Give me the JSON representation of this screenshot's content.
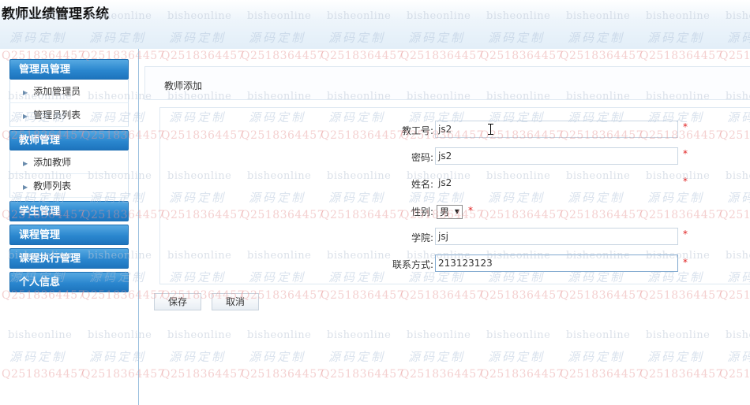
{
  "app": {
    "title": "教师业绩管理系统"
  },
  "sidebar": {
    "groups": [
      {
        "label": "管理员管理",
        "items": [
          {
            "label": "添加管理员"
          },
          {
            "label": "管理员列表"
          }
        ]
      },
      {
        "label": "教师管理",
        "items": [
          {
            "label": "添加教师"
          },
          {
            "label": "教师列表"
          }
        ]
      },
      {
        "label": "学生管理",
        "items": []
      },
      {
        "label": "课程管理",
        "items": []
      },
      {
        "label": "课程执行管理",
        "items": []
      },
      {
        "label": "个人信息",
        "items": []
      }
    ]
  },
  "panel": {
    "title": "教师添加"
  },
  "form": {
    "required_mark": "*",
    "fields": {
      "staff_id": {
        "label": "教工号:",
        "value": "js2"
      },
      "password": {
        "label": "密码:",
        "value": "js2"
      },
      "name": {
        "label": "姓名:",
        "value": "js2"
      },
      "gender": {
        "label": "性别:",
        "selected": "男"
      },
      "college": {
        "label": "学院:",
        "value": "jsj"
      },
      "contact": {
        "label": "联系方式:",
        "value": "213123123"
      }
    },
    "save_label": "保存",
    "cancel_label": "取消"
  },
  "watermarks": {
    "text_a": "bisheonline",
    "text_b": "源码定制",
    "text_c": "Q2518364457"
  },
  "icons": {
    "menu_item": "triangle-right-icon",
    "select": "caret-down-icon",
    "cursor": "text-cursor-icon"
  },
  "colors": {
    "menu_head": "#2b87cf",
    "required": "#e02020"
  }
}
